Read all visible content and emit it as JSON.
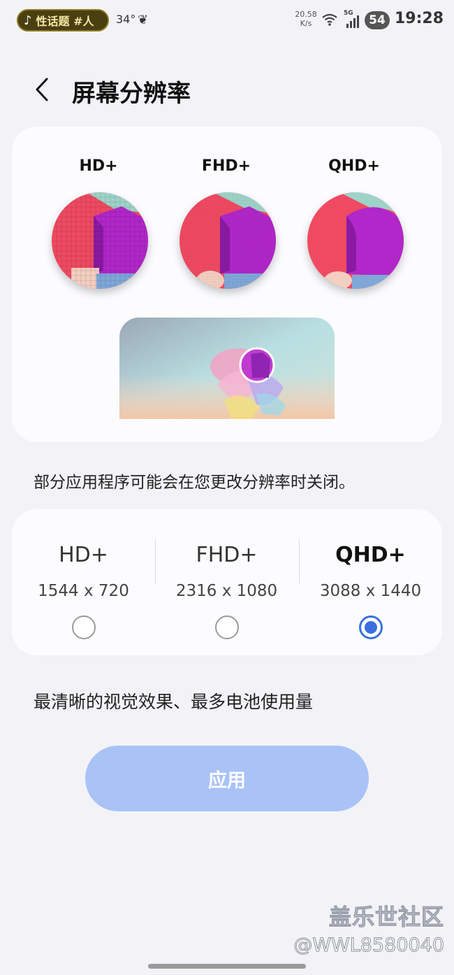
{
  "status_bar": {
    "notification_text": "性话题 #人",
    "temperature": "34°",
    "net_speed_value": "20.58",
    "net_speed_unit": "K/s",
    "network_type": "5G",
    "battery_level": "54",
    "time": "19:28"
  },
  "header": {
    "title": "屏幕分辨率"
  },
  "preview": {
    "labels": [
      "HD+",
      "FHD+",
      "QHD+"
    ]
  },
  "notice": "部分应用程序可能会在您更改分辨率时关闭。",
  "options": [
    {
      "name": "HD+",
      "resolution": "1544 x 720",
      "selected": false
    },
    {
      "name": "FHD+",
      "resolution": "2316 x 1080",
      "selected": false
    },
    {
      "name": "QHD+",
      "resolution": "3088 x 1440",
      "selected": true
    }
  ],
  "description": "最清晰的视觉效果、最多电池使用量",
  "apply_label": "应用",
  "watermark": {
    "site": "盖乐世社区",
    "user": "@WWL8580040"
  },
  "colors": {
    "accent": "#3b6fe0",
    "apply_button": "#a9c3f7",
    "card": "#fcfcff",
    "background": "#f3f3f7"
  }
}
